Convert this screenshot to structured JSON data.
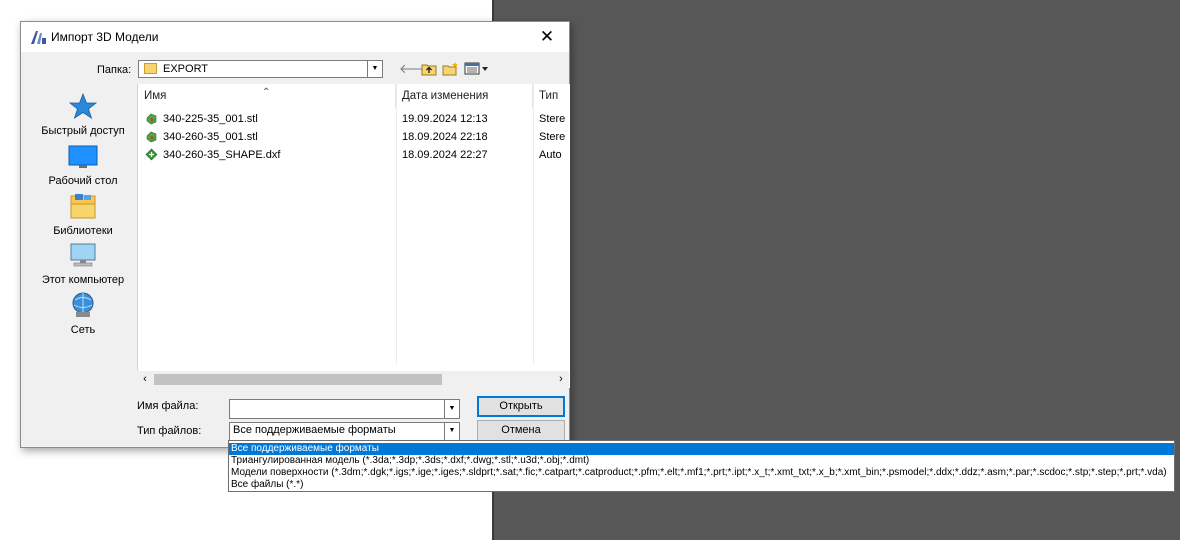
{
  "dialog": {
    "title": "Импорт 3D Модели",
    "close_glyph": "✕",
    "folder_label": "Папка:",
    "folder_value": "EXPORT",
    "toolbar_icons": [
      "back-arrow-icon",
      "up-folder-icon",
      "new-folder-icon",
      "view-menu-icon"
    ]
  },
  "places": [
    {
      "label": "Быстрый доступ",
      "icon": "star-icon"
    },
    {
      "label": "Рабочий стол",
      "icon": "desktop-icon"
    },
    {
      "label": "Библиотеки",
      "icon": "libraries-icon"
    },
    {
      "label": "Этот компьютер",
      "icon": "computer-icon"
    },
    {
      "label": "Сеть",
      "icon": "network-icon"
    }
  ],
  "columns": [
    "Имя",
    "Дата изменения",
    "Тип"
  ],
  "files": [
    {
      "name": "340-225-35_001.stl",
      "date": "19.09.2024 12:13",
      "type": "Stere",
      "icon": "stl-file-icon"
    },
    {
      "name": "340-260-35_001.stl",
      "date": "18.09.2024 22:18",
      "type": "Stere",
      "icon": "stl-file-icon"
    },
    {
      "name": "340-260-35_SHAPE.dxf",
      "date": "18.09.2024 22:27",
      "type": "Auto",
      "icon": "dxf-file-icon"
    }
  ],
  "filename": {
    "label": "Имя файла:",
    "value": ""
  },
  "filetype": {
    "label": "Тип файлов:",
    "value": "Все поддерживаемые форматы",
    "options": [
      "Все поддерживаемые форматы",
      "Триангулированная модель (*.3da;*.3dp;*.3ds;*.dxf;*.dwg;*.stl;*.u3d;*.obj;*.dmt)",
      "Модели поверхности (*.3dm;*.dgk;*.igs;*.ige;*.iges;*.sldprt;*.sat;*.fic;*.catpart;*.catproduct;*.pfm;*.elt;*.mf1;*.prt;*.ipt;*.x_t;*.xmt_txt;*.x_b;*.xmt_bin;*.psmodel;*.ddx;*.ddz;*.asm;*.par;*.scdoc;*.stp;*.step;*.prt;*.vda)",
      "Все файлы (*.*)"
    ]
  },
  "buttons": {
    "open": "Открыть",
    "cancel": "Отмена"
  },
  "colors": {
    "accent": "#0078d7",
    "background_dark": "#575757",
    "dialog_bg": "#f0f0f0"
  }
}
